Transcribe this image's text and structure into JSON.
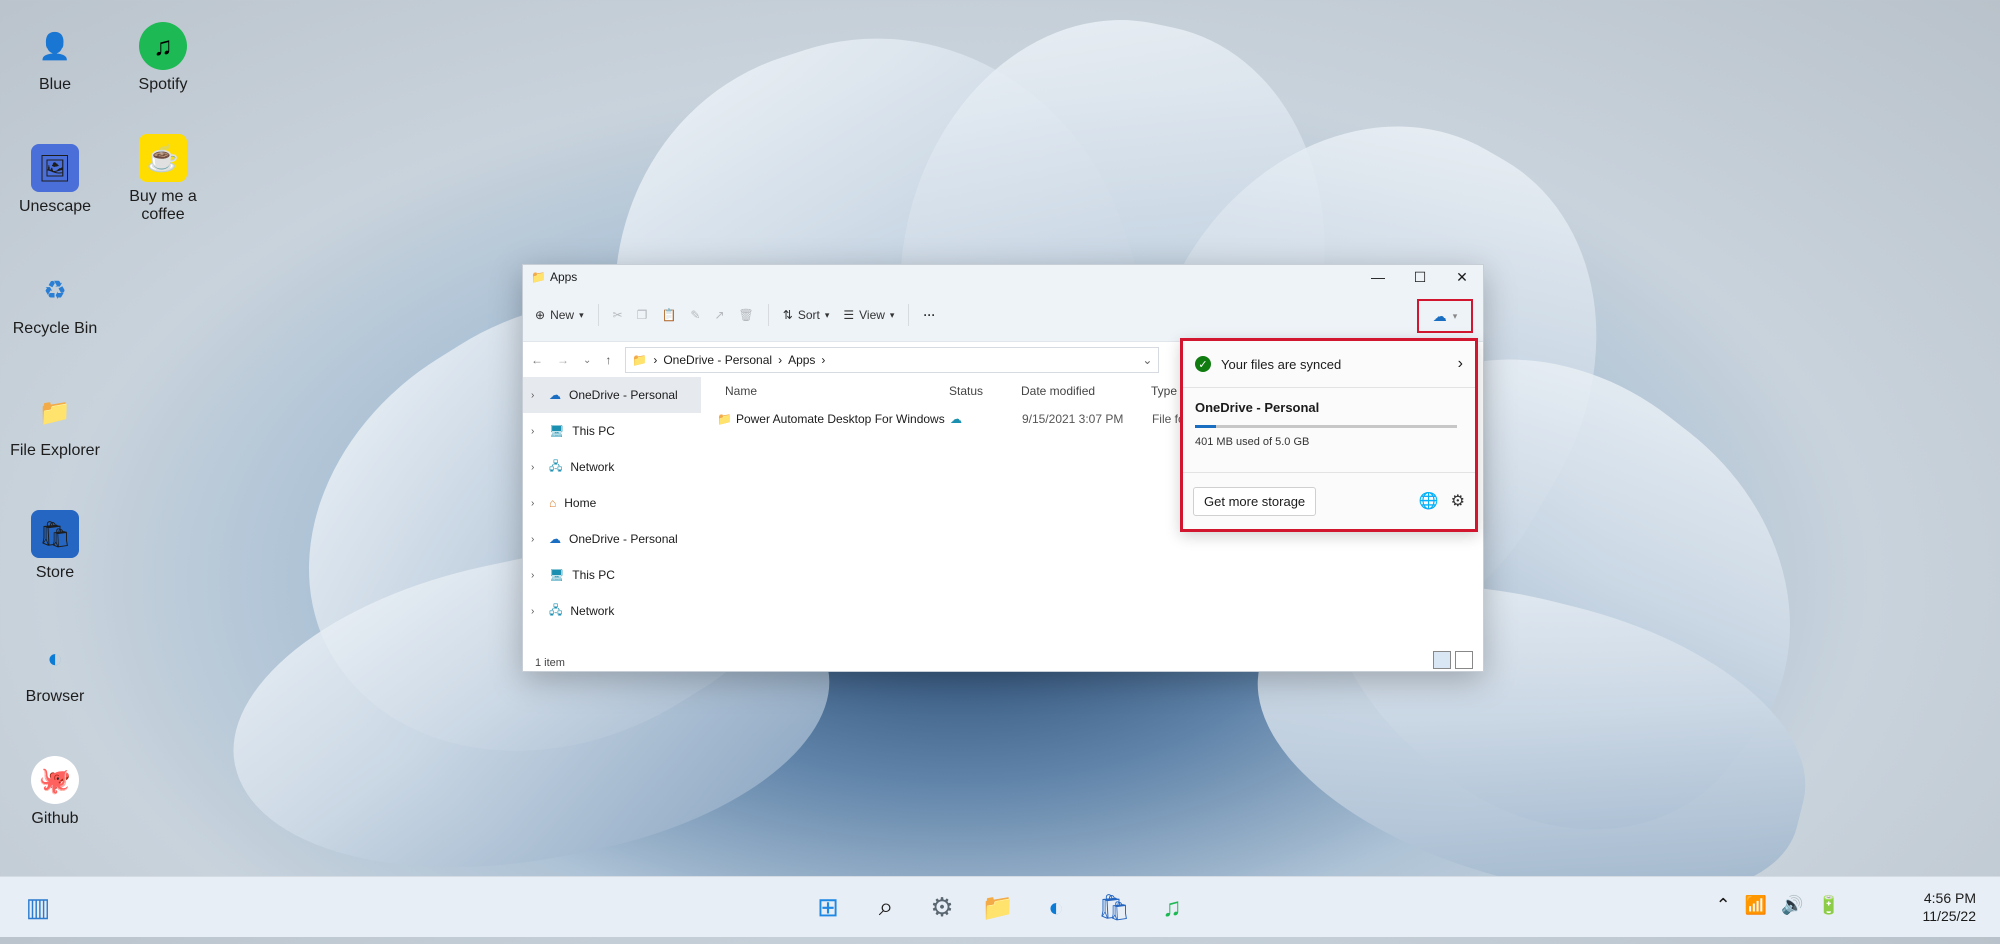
{
  "desktop": {
    "icons": [
      {
        "label": "Blue",
        "glyph": "👤"
      },
      {
        "label": "Spotify",
        "glyph": "♫"
      },
      {
        "label": "Unescape",
        "glyph": "🖼"
      },
      {
        "label": "Buy me a coffee",
        "glyph": "☕"
      },
      {
        "label": "Recycle Bin",
        "glyph": "♻"
      },
      {
        "label": "File Explorer",
        "glyph": "📁"
      },
      {
        "label": "Store",
        "glyph": "🛍"
      },
      {
        "label": "Browser",
        "glyph": "◐"
      },
      {
        "label": "Github",
        "glyph": "🐙"
      }
    ]
  },
  "explorer": {
    "title": "Apps",
    "toolbar": {
      "new": "New",
      "sort": "Sort",
      "view": "View",
      "more": "···"
    },
    "breadcrumb": [
      "OneDrive - Personal",
      "Apps"
    ],
    "nav": [
      {
        "label": "OneDrive - Personal",
        "icon": "cloud-icon"
      },
      {
        "label": "This PC",
        "icon": "pc-icon"
      },
      {
        "label": "Network",
        "icon": "network-icon"
      },
      {
        "label": "Home",
        "icon": "home-icon"
      },
      {
        "label": "OneDrive - Personal",
        "icon": "cloud-icon"
      },
      {
        "label": "This PC",
        "icon": "pc-icon"
      },
      {
        "label": "Network",
        "icon": "network-icon"
      }
    ],
    "columns": {
      "name": "Name",
      "status": "Status",
      "date": "Date modified",
      "type": "Type"
    },
    "rows": [
      {
        "name": "Power Automate Desktop For Windows",
        "date": "9/15/2021 3:07 PM",
        "type": "File fo"
      }
    ],
    "status_text": "1 item"
  },
  "flyout": {
    "sync_text": "Your files are synced",
    "account": "OneDrive - Personal",
    "usage_text": "401 MB used of 5.0 GB",
    "usage_fraction": 0.08,
    "storage_button": "Get more storage"
  },
  "taskbar": {
    "time": "4:56 PM",
    "date": "11/25/22"
  },
  "colors": {
    "accent": "#1a6ec2",
    "highlight": "#d3162f",
    "synced": "#107c10"
  }
}
